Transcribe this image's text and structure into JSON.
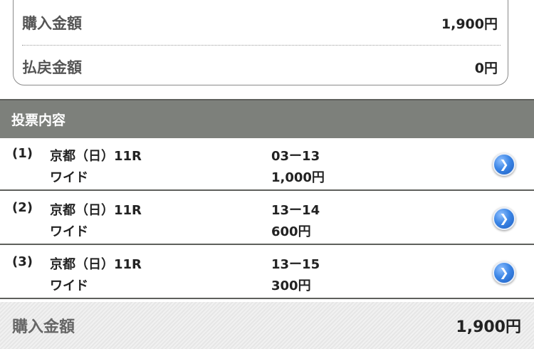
{
  "summary": {
    "purchase_label": "購入金額",
    "purchase_value": "1,900円",
    "refund_label": "払戻金額",
    "refund_value": "0円"
  },
  "section": {
    "title": "投票内容"
  },
  "bets": [
    {
      "num": "(1)",
      "race": "京都（日）11R",
      "type": "ワイド",
      "combo": "03ー13",
      "amount": "1,000円"
    },
    {
      "num": "(2)",
      "race": "京都（日）11R",
      "type": "ワイド",
      "combo": "13ー14",
      "amount": "600円"
    },
    {
      "num": "(3)",
      "race": "京都（日）11R",
      "type": "ワイド",
      "combo": "13ー15",
      "amount": "300円"
    }
  ],
  "total": {
    "label": "購入金額",
    "value": "1,900円"
  },
  "icons": {
    "detail_button": "chevron-right-icon"
  },
  "colors": {
    "header_bg": "#7d807b",
    "button_blue": "#3c86e6"
  }
}
